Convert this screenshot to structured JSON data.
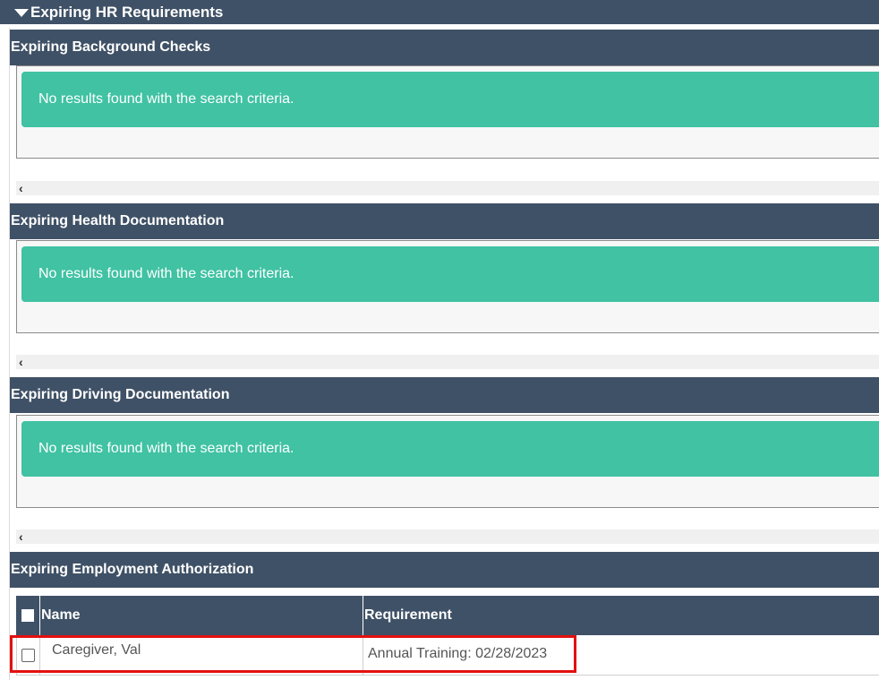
{
  "main_header": {
    "title": "Expiring HR Requirements"
  },
  "sections": [
    {
      "title": "Expiring Background Checks",
      "message": "No results found with the search criteria."
    },
    {
      "title": "Expiring Health Documentation",
      "message": "No results found with the search criteria."
    },
    {
      "title": "Expiring Driving Documentation",
      "message": "No results found with the search criteria."
    },
    {
      "title": "Expiring Employment Authorization"
    }
  ],
  "scroll_glyph": "‹",
  "table": {
    "columns": [
      "Name",
      "Requirement"
    ],
    "rows": [
      {
        "name": "Caregiver, Val",
        "requirement": "Annual Training: 02/28/2023"
      }
    ]
  },
  "colors": {
    "header_bg": "#3f5166",
    "alert_bg": "#40c2a3",
    "highlight": "#e31010"
  }
}
